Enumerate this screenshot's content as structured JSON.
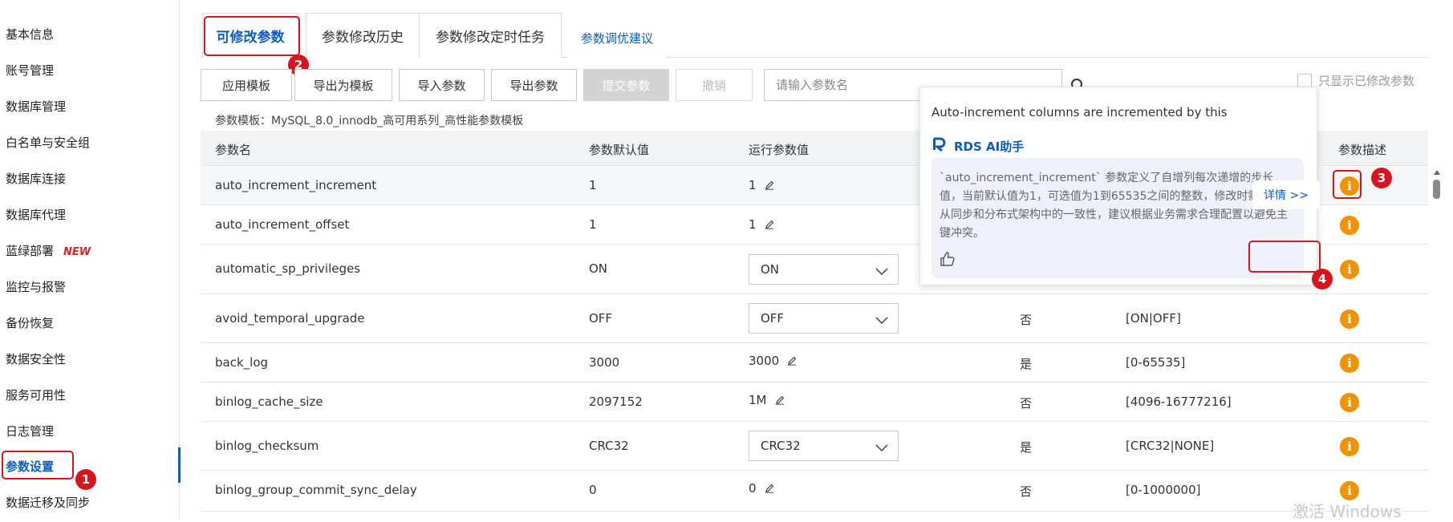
{
  "sidebar": {
    "items": [
      {
        "label": "基本信息"
      },
      {
        "label": "账号管理"
      },
      {
        "label": "数据库管理"
      },
      {
        "label": "白名单与安全组"
      },
      {
        "label": "数据库连接"
      },
      {
        "label": "数据库代理"
      },
      {
        "label": "蓝绿部署",
        "badge": "NEW"
      },
      {
        "label": "监控与报警"
      },
      {
        "label": "备份恢复"
      },
      {
        "label": "数据安全性"
      },
      {
        "label": "服务可用性"
      },
      {
        "label": "日志管理"
      },
      {
        "label": "参数设置",
        "active": true
      },
      {
        "label": "数据迁移及同步"
      }
    ]
  },
  "tabs": [
    {
      "label": "可修改参数",
      "active": true
    },
    {
      "label": "参数修改历史"
    },
    {
      "label": "参数修改定时任务"
    },
    {
      "label": "参数调优建议"
    }
  ],
  "toolbar": {
    "apply_template": "应用模板",
    "export_as_template": "导出为模板",
    "import_params": "导入参数",
    "export_params": "导出参数",
    "submit_params": "提交参数",
    "undo": "撤销",
    "search_placeholder": "请输入参数名",
    "only_changed": "只显示已修改参数"
  },
  "template_line": "参数模板：MySQL_8.0_innodb_高可用系列_高性能参数模板",
  "table": {
    "headers": {
      "name": "参数名",
      "default": "参数默认值",
      "running": "运行参数值",
      "desc": "参数描述"
    },
    "rows": [
      {
        "name": "auto_increment_increment",
        "default": "1",
        "running": "1",
        "editable": "pencil"
      },
      {
        "name": "auto_increment_offset",
        "default": "1",
        "running": "1",
        "editable": "pencil"
      },
      {
        "name": "automatic_sp_privileges",
        "default": "ON",
        "running": "ON",
        "editable": "select"
      },
      {
        "name": "avoid_temporal_upgrade",
        "default": "OFF",
        "running": "OFF",
        "editable": "select",
        "restart": "否",
        "range": "[ON|OFF]"
      },
      {
        "name": "back_log",
        "default": "3000",
        "running": "3000",
        "editable": "pencil",
        "restart": "是",
        "range": "[0-65535]"
      },
      {
        "name": "binlog_cache_size",
        "default": "2097152",
        "running": "1M",
        "editable": "pencil",
        "restart": "否",
        "range": "[4096-16777216]"
      },
      {
        "name": "binlog_checksum",
        "default": "CRC32",
        "running": "CRC32",
        "editable": "select",
        "restart": "是",
        "range": "[CRC32|NONE]"
      },
      {
        "name": "binlog_group_commit_sync_delay",
        "default": "0",
        "running": "0",
        "editable": "pencil",
        "restart": "否",
        "range": "[0-1000000]"
      }
    ]
  },
  "popover": {
    "title": "Auto-increment columns are incremented by this",
    "ai_name": "RDS AI助手",
    "ai_text": "`auto_increment_increment` 参数定义了自增列每次递增的步长值，当前默认值为1，可选值为1到65535之间的整数，修改时需确保主从同步和分布式架构中的一致性，建议根据业务需求合理配置以避免主键冲突。",
    "detail_link": "详情 >>"
  },
  "annotations": [
    "1",
    "2",
    "3",
    "4"
  ],
  "watermark": "激活 Windows",
  "colors": {
    "accent": "#0b5bc7",
    "highlight": "#d9141c",
    "info": "#f39200",
    "new_badge": "#e02020"
  }
}
